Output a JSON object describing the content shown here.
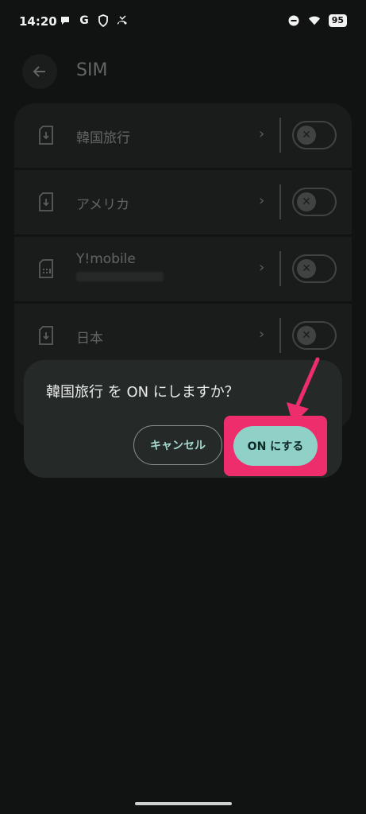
{
  "status": {
    "time": "14:20",
    "battery": "95",
    "left_icons": [
      "chat-bubble-icon",
      "google-g-icon",
      "shield-icon",
      "missed-call-icon"
    ],
    "right_icons": [
      "dnd-icon",
      "wifi-icon",
      "battery-icon"
    ]
  },
  "appbar": {
    "title": "SIM"
  },
  "sims": [
    {
      "label": "韓国旅行",
      "icon": "esim-download-icon",
      "enabled": false
    },
    {
      "label": "アメリカ",
      "icon": "esim-download-icon",
      "enabled": false
    },
    {
      "label": "Y!mobile",
      "icon": "sim-card-icon",
      "enabled": false
    },
    {
      "label": "日本",
      "icon": "esim-download-icon",
      "enabled": false
    }
  ],
  "dialog": {
    "message": "韓国旅行 を ON にしますか？",
    "cancel_label": "キャンセル",
    "confirm_label": "ON にする"
  },
  "annotation": {
    "highlight_color": "#ee2d6c"
  },
  "colors": {
    "accent": "#8fd1c6",
    "background": "#111312"
  }
}
